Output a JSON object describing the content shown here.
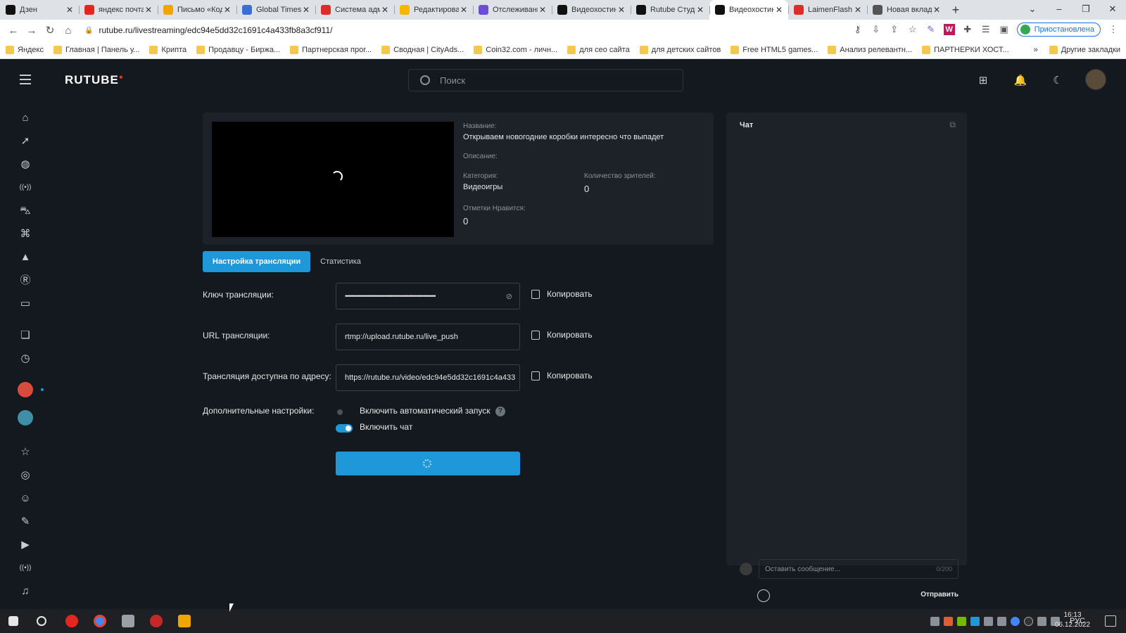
{
  "browser": {
    "tabs": [
      {
        "label": "Дзен",
        "fav_color": "#111111"
      },
      {
        "label": "яндекс почта",
        "fav_color": "#e52620"
      },
      {
        "label": "Письмо «Код",
        "fav_color": "#f0a500"
      },
      {
        "label": "Global Times",
        "fav_color": "#3b6fd8"
      },
      {
        "label": "Система адм",
        "fav_color": "#e02b2b"
      },
      {
        "label": "Редактирован",
        "fav_color": "#f5b800"
      },
      {
        "label": "Отслеживани",
        "fav_color": "#6b4fd8"
      },
      {
        "label": "Видеохостин",
        "fav_color": "#111111"
      },
      {
        "label": "Rutube Студи",
        "fav_color": "#111111"
      },
      {
        "label": "Видеохостин",
        "fav_color": "#111111",
        "active": true
      },
      {
        "label": "LaimenFlash",
        "fav_color": "#e02b2b"
      },
      {
        "label": "Новая вклад",
        "fav_color": "#555555"
      }
    ],
    "url": "rutube.ru/livestreaming/edc94e5dd32c1691c4a433fb8a3cf911/",
    "profile_label": "Приостановлена",
    "bookmarks": [
      "Яндекс",
      "Главная | Панель у...",
      "Крипта",
      "Продавцу - Биржа...",
      "Партнерская прог...",
      "Сводная | CityAds...",
      "Coin32.com - личн...",
      "для сео сайта",
      "для детских сайтов",
      "Free HTML5 games...",
      "Анализ релевантн...",
      "ПАРТНЕРКИ ХОСТ..."
    ],
    "bookmarks_more": "»",
    "other_bookmarks": "Другие закладки"
  },
  "app": {
    "logo": "RUTUBE",
    "search_placeholder": "Поиск",
    "stream": {
      "title_label": "Название:",
      "title": "Открываем новогодние коробки интересно что выпадет",
      "description_label": "Описание:",
      "category_label": "Категория:",
      "category": "Видеоигры",
      "viewers_label": "Количество зрителей:",
      "viewers": "0",
      "likes_label": "Отметки Нравится:",
      "likes": "0"
    },
    "tabs": {
      "settings": "Настройка трансляции",
      "stats": "Статистика"
    },
    "form": {
      "key_label": "Ключ трансляции:",
      "key_value": "••••••••••••••••••••••••••••••••••••••••••••••••••••••••••••",
      "url_label": "URL трансляции:",
      "url_value": "rtmp://upload.rutube.ru/live_push",
      "address_label": "Трансляция доступна по адресу:",
      "address_value": "https://rutube.ru/video/edc94e5dd32c1691c4a433",
      "copy_label": "Копировать",
      "extra_label": "Дополнительные настройки:",
      "autostart_label": "Включить автоматический запуск",
      "autostart_on": false,
      "chat_toggle_label": "Включить чат",
      "chat_on": true,
      "help_glyph": "?"
    },
    "chat": {
      "title": "Чат",
      "input_placeholder": "Оставить сообщение...",
      "counter": "0/200",
      "send_label": "Отправить"
    }
  },
  "taskbar": {
    "lang": "РУС",
    "time": "16:13",
    "date": "06.12.2022"
  },
  "colors": {
    "accent": "#1f98d9",
    "background": "#14191f",
    "panel": "#1c2228"
  }
}
